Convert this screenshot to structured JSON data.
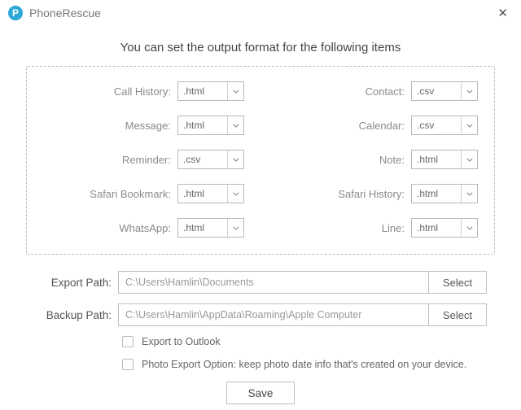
{
  "app": {
    "title": "PhoneRescue",
    "heading": "You can set the output format for the following items"
  },
  "formats": [
    {
      "label": "Call History:",
      "value": ".html"
    },
    {
      "label": "Contact:",
      "value": ".csv"
    },
    {
      "label": "Message:",
      "value": ".html"
    },
    {
      "label": "Calendar:",
      "value": ".csv"
    },
    {
      "label": "Reminder:",
      "value": ".csv"
    },
    {
      "label": "Note:",
      "value": ".html"
    },
    {
      "label": "Safari Bookmark:",
      "value": ".html"
    },
    {
      "label": "Safari History:",
      "value": ".html"
    },
    {
      "label": "WhatsApp:",
      "value": ".html"
    },
    {
      "label": "Line:",
      "value": ".html"
    }
  ],
  "paths": {
    "export_label": "Export Path:",
    "export_value": "C:\\Users\\Hamlin\\Documents",
    "backup_label": "Backup Path:",
    "backup_value": "C:\\Users\\Hamlin\\AppData\\Roaming\\Apple Computer",
    "select_label": "Select"
  },
  "checks": {
    "outlook": "Export to Outlook",
    "photo": "Photo Export Option: keep photo date info that's created on your device."
  },
  "buttons": {
    "save": "Save"
  }
}
